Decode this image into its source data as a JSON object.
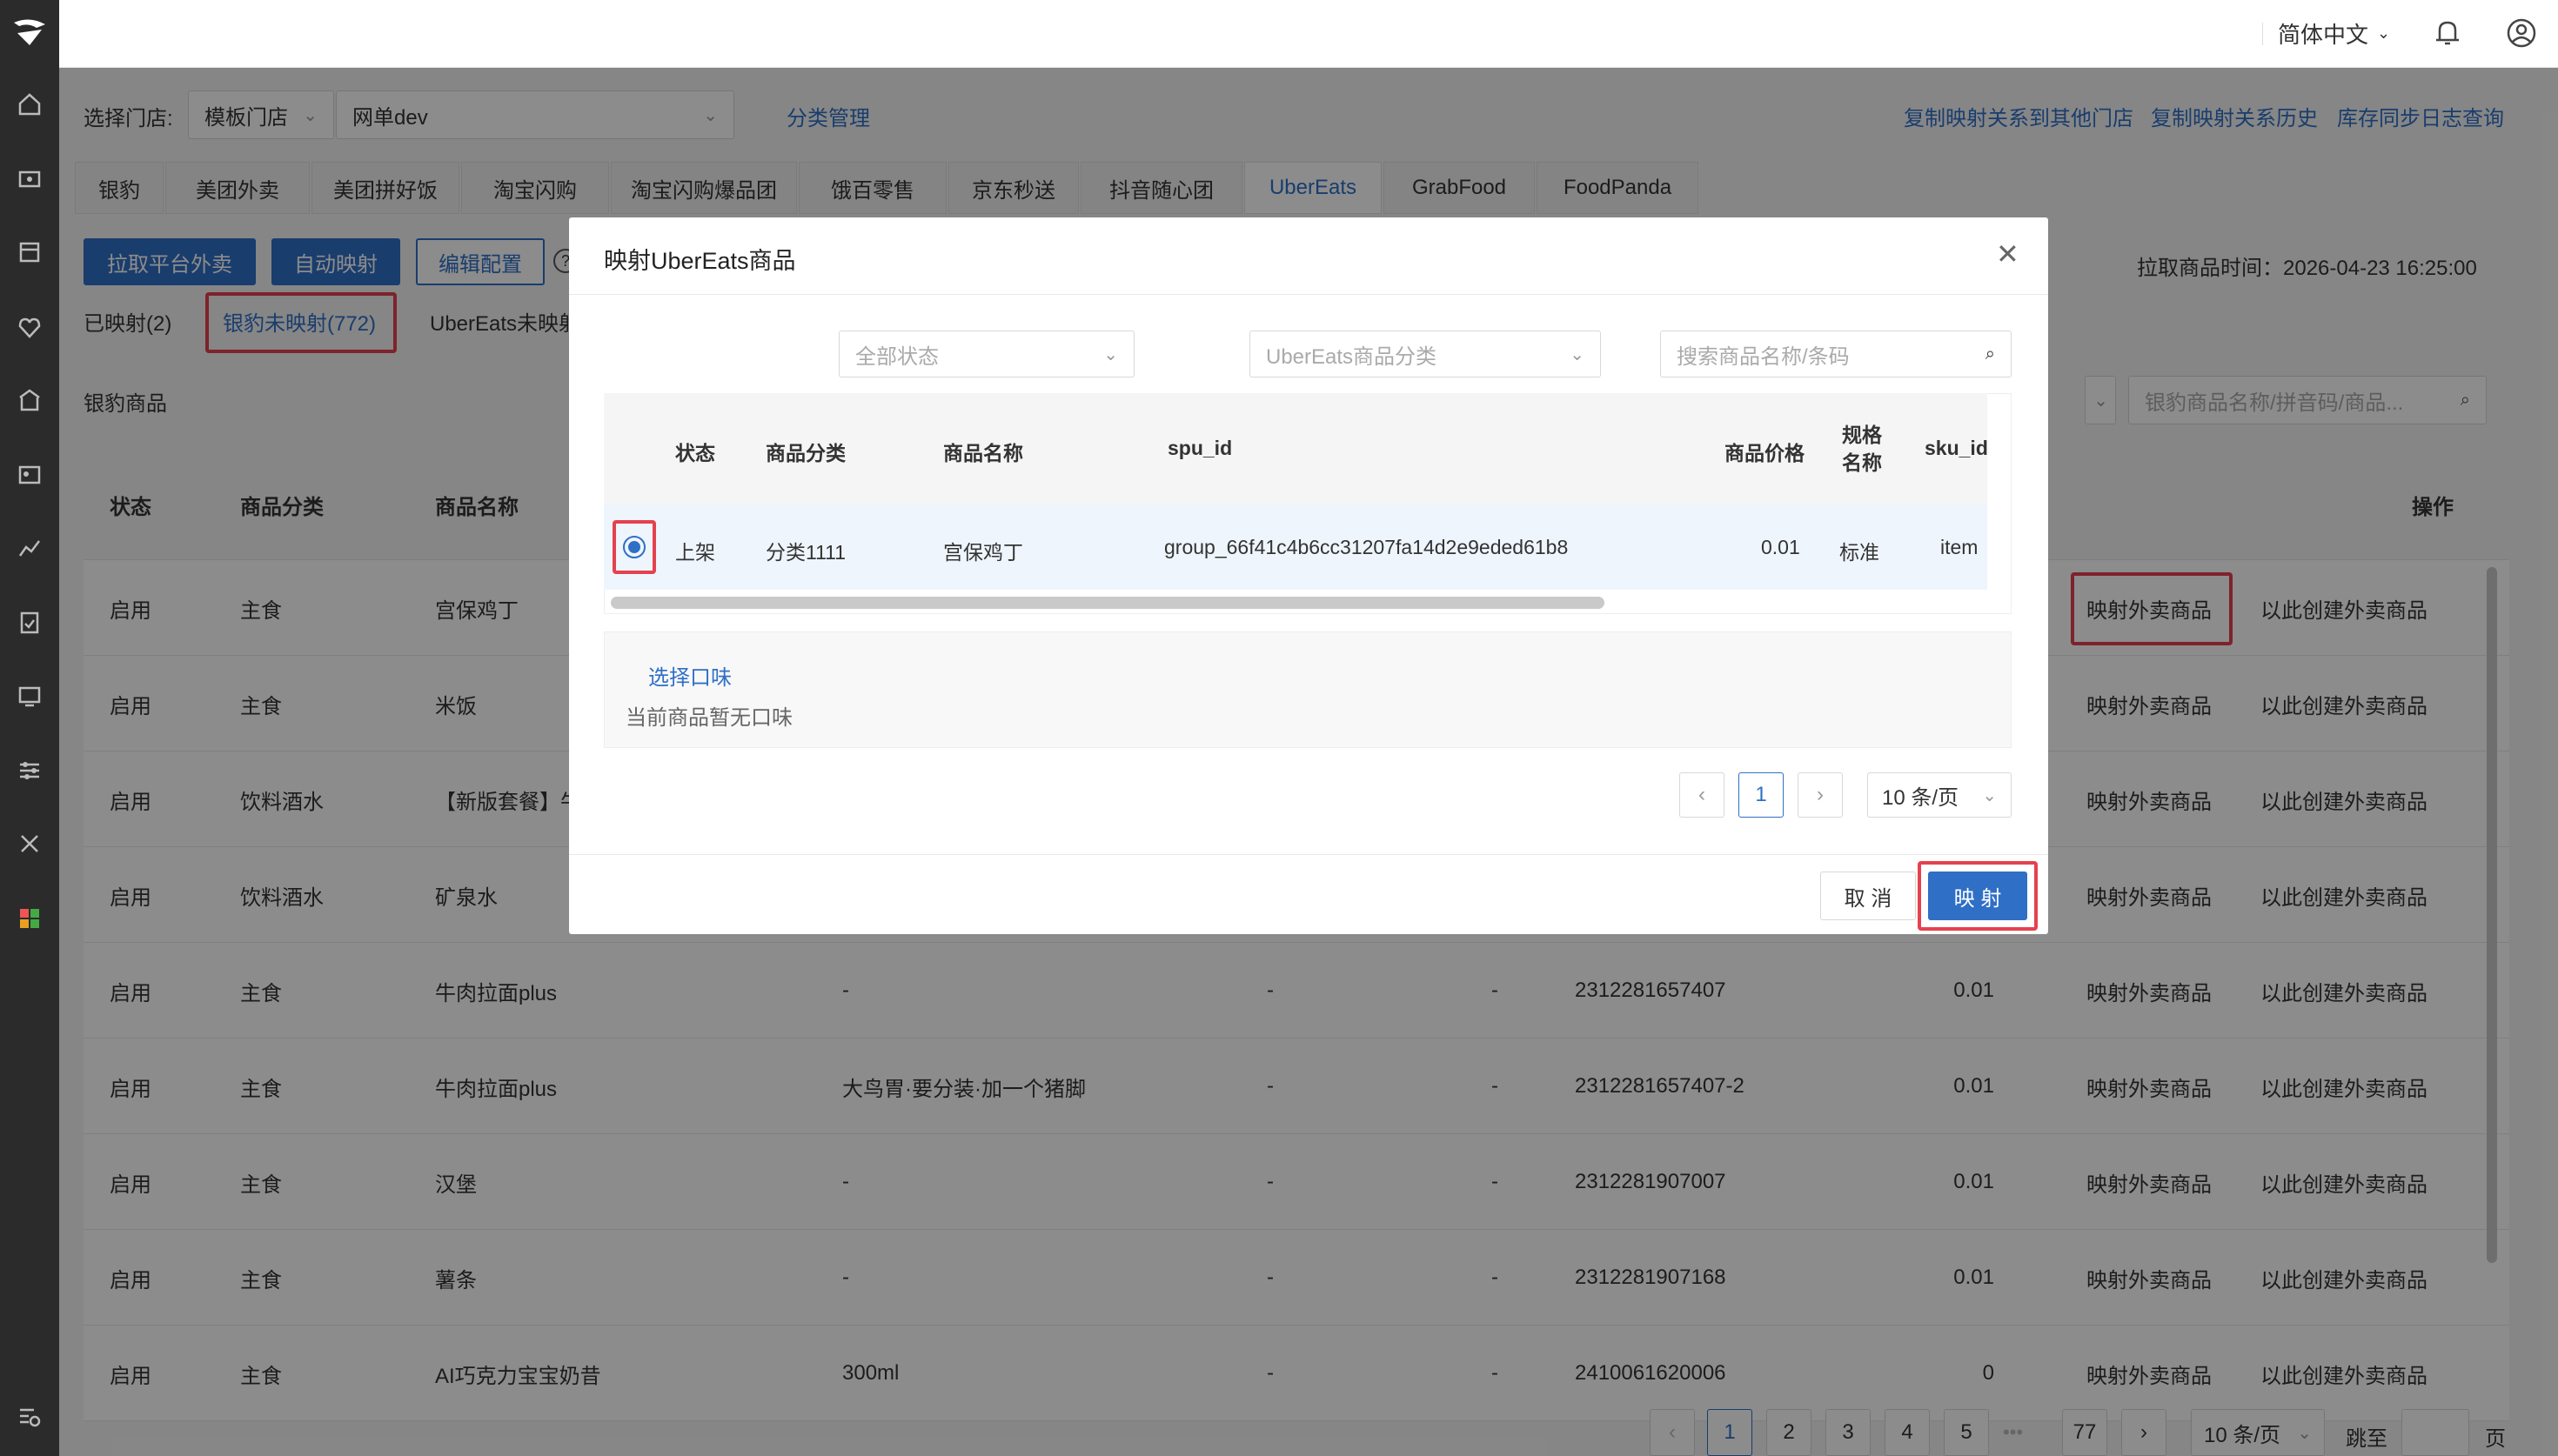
{
  "topbar": {
    "language": "简体中文"
  },
  "toolbar": {
    "store_label": "选择门店:",
    "store_type": "模板门店",
    "store_name": "网单dev",
    "category_mgmt": "分类管理",
    "copy_mapping": "复制映射关系到其他门店",
    "copy_history": "复制映射关系历史",
    "stock_log": "库存同步日志查询"
  },
  "platform_tabs": [
    "银豹",
    "美团外卖",
    "美团拼好饭",
    "淘宝闪购",
    "淘宝闪购爆品团",
    "饿百零售",
    "京东秒送",
    "抖音随心团",
    "UberEats",
    "GrabFood",
    "FoodPanda"
  ],
  "actions": {
    "pull": "拉取平台外卖",
    "auto_map": "自动映射",
    "edit_config": "编辑配置",
    "help": "?",
    "pull_time": "拉取商品时间：2026-04-23 16:25:00"
  },
  "subtabs": {
    "mapped": "已映射(2)",
    "unmapped": "银豹未映射(772)",
    "uber_unmapped": "UberEats未映射"
  },
  "section": {
    "title": "银豹商品",
    "search_placeholder": "银豹商品名称/拼音码/商品..."
  },
  "table": {
    "headers": {
      "status": "状态",
      "category": "商品分类",
      "name": "商品名称",
      "ops": "操作"
    },
    "rows": [
      {
        "status": "启用",
        "category": "主食",
        "name": "宫保鸡丁",
        "spec": "",
        "c4": "",
        "c5": "",
        "code": "",
        "price": "",
        "op1": "映射外卖商品",
        "op2": "以此创建外卖商品"
      },
      {
        "status": "启用",
        "category": "主食",
        "name": "米饭",
        "spec": "",
        "c4": "",
        "c5": "",
        "code": "",
        "price": "",
        "op1": "映射外卖商品",
        "op2": "以此创建外卖商品"
      },
      {
        "status": "启用",
        "category": "饮料酒水",
        "name": "【新版套餐】牛",
        "spec": "",
        "c4": "",
        "c5": "",
        "code": "",
        "price": "",
        "op1": "映射外卖商品",
        "op2": "以此创建外卖商品"
      },
      {
        "status": "启用",
        "category": "饮料酒水",
        "name": "矿泉水",
        "spec": "",
        "c4": "",
        "c5": "",
        "code": "",
        "price": "",
        "op1": "映射外卖商品",
        "op2": "以此创建外卖商品"
      },
      {
        "status": "启用",
        "category": "主食",
        "name": "牛肉拉面plus",
        "spec": "-",
        "c4": "-",
        "c5": "-",
        "code": "2312281657407",
        "price": "0.01",
        "op1": "映射外卖商品",
        "op2": "以此创建外卖商品"
      },
      {
        "status": "启用",
        "category": "主食",
        "name": "牛肉拉面plus",
        "spec": "大鸟胃·要分装·加一个猪脚",
        "c4": "-",
        "c5": "-",
        "code": "2312281657407-2",
        "price": "0.01",
        "op1": "映射外卖商品",
        "op2": "以此创建外卖商品"
      },
      {
        "status": "启用",
        "category": "主食",
        "name": "汉堡",
        "spec": "-",
        "c4": "-",
        "c5": "-",
        "code": "2312281907007",
        "price": "0.01",
        "op1": "映射外卖商品",
        "op2": "以此创建外卖商品"
      },
      {
        "status": "启用",
        "category": "主食",
        "name": "薯条",
        "spec": "-",
        "c4": "-",
        "c5": "-",
        "code": "2312281907168",
        "price": "0.01",
        "op1": "映射外卖商品",
        "op2": "以此创建外卖商品"
      },
      {
        "status": "启用",
        "category": "主食",
        "name": "AI巧克力宝宝奶昔",
        "spec": "300ml",
        "c4": "-",
        "c5": "-",
        "code": "2410061620006",
        "price": "0",
        "op1": "映射外卖商品",
        "op2": "以此创建外卖商品"
      }
    ]
  },
  "bottom_pagination": {
    "pages": [
      "1",
      "2",
      "3",
      "4",
      "5",
      "•••",
      "77"
    ],
    "page_size": "10 条/页",
    "jump": "跳至",
    "page_unit": "页"
  },
  "modal": {
    "title": "映射UberEats商品",
    "status_placeholder": "全部状态",
    "category_placeholder": "UberEats商品分类",
    "search_placeholder": "搜索商品名称/条码",
    "headers": {
      "status": "状态",
      "category": "商品分类",
      "name": "商品名称",
      "spu": "spu_id",
      "price": "商品价格",
      "spec": "规格名称",
      "sku": "sku_id"
    },
    "row": {
      "status": "上架",
      "category": "分类1111",
      "name": "宫保鸡丁",
      "spu": "group_66f41c4b6cc31207fa14d2e9eded61b8",
      "price": "0.01",
      "spec": "标准",
      "sku": "item"
    },
    "flavor_link": "选择口味",
    "flavor_empty": "当前商品暂无口味",
    "page": "1",
    "page_size": "10 条/页",
    "cancel": "取 消",
    "confirm": "映 射"
  },
  "colors": {
    "accent": "#2f6fc6",
    "highlight": "#e5414f",
    "sidebar": "#2b2b2b"
  }
}
